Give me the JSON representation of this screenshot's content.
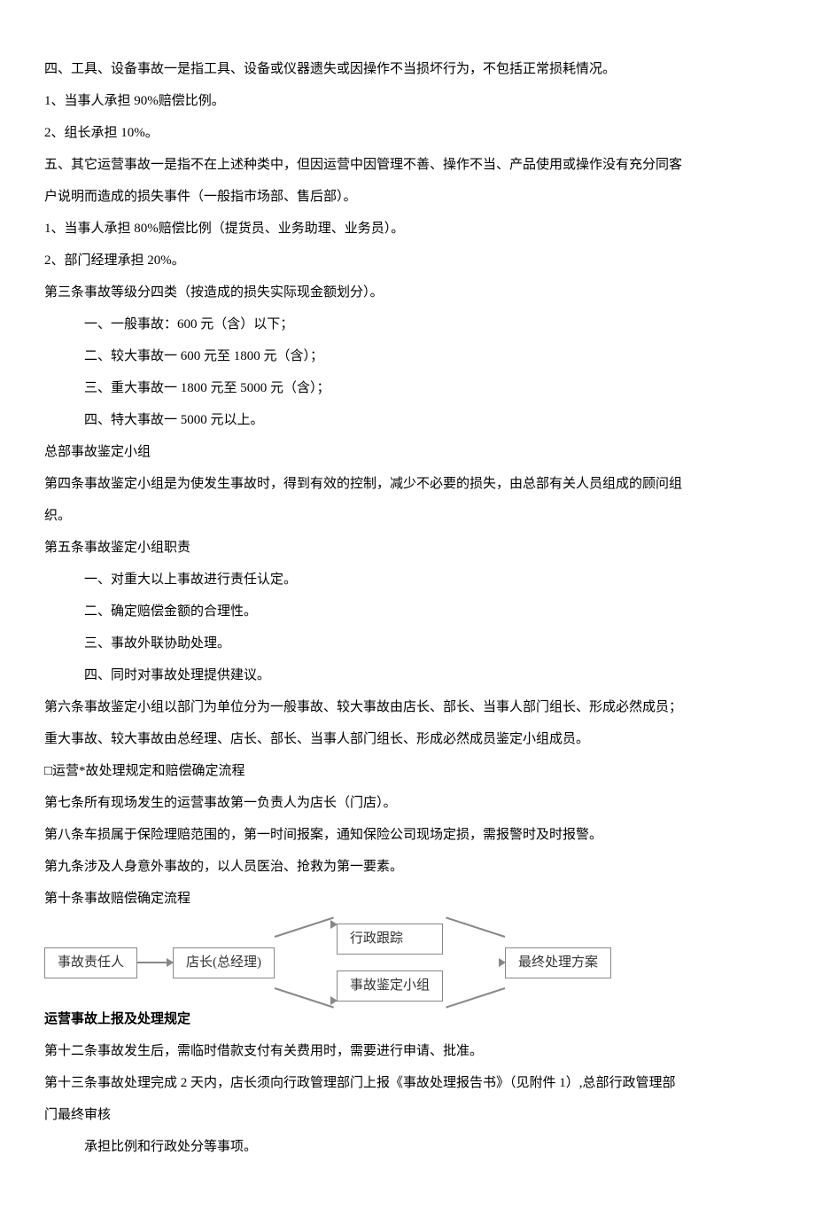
{
  "p1": "四、工具、设备事故一是指工具、设备或仪器遗失或因操作不当损坏行为，不包括正常损耗情况。",
  "p2": "1、当事人承担 90%赔偿比例。",
  "p3": "2、组长承担 10%。",
  "p4": "五、其它运营事故一是指不在上述种类中，但因运营中因管理不善、操作不当、产品使用或操作没有充分同客户说明而造成的损失事件（一般指市场部、售后部）。",
  "p5": "1、当事人承担 80%赔偿比例（提货员、业务助理、业务员）。",
  "p6": "2、部门经理承担 20%。",
  "p7": "第三条事故等级分四类（按造成的损失实际现金额划分）。",
  "p8": "一、一般事故：600 元（含）以下；",
  "p9": "二、较大事故一 600 元至 1800 元（含）；",
  "p10": "三、重大事故一 1800 元至 5000 元（含）；",
  "p11": "四、特大事故一 5000 元以上。",
  "p12": "总部事故鉴定小组",
  "p13": "第四条事故鉴定小组是为使发生事故时，得到有效的控制，减少不必要的损失，由总部有关人员组成的顾问组织。",
  "p14": "第五条事故鉴定小组职责",
  "p15": "一、对重大以上事故进行责任认定。",
  "p16": "二、确定赔偿金额的合理性。",
  "p17": "三、事故外联协助处理。",
  "p18": "四、同时对事故处理提供建议。",
  "p19": "第六条事故鉴定小组以部门为单位分为一般事故、较大事故由店长、部长、当事人部门组长、形成必然成员；重大事故、较大事故由总经理、店长、部长、当事人部门组长、形成必然成员鉴定小组成员。",
  "p20": "□运营*故处理规定和赔偿确定流程",
  "p21": "第七条所有现场发生的运营事故第一负责人为店长（门店）。",
  "p22": "第八条车损属于保险理赔范围的，第一时间报案，通知保险公司现场定损，需报警时及时报警。",
  "p23": "第九条涉及人身意外事故的，以人员医治、抢救为第一要素。",
  "p24": "第十条事故赔偿确定流程",
  "flow": {
    "b1": "事故责任人",
    "b2": "店长(总经理)",
    "b3": "行政跟踪",
    "b4": "事故鉴定小组",
    "b5": "最终处理方案"
  },
  "p25": "运营事故上报及处理规定",
  "p26": "第十二条事故发生后，需临时借款支付有关费用时，需要进行申请、批准。",
  "p27": "第十三条事故处理完成 2 天内，店长须向行政管理部门上报《事故处理报告书》（见附件 1）,总部行政管理部门最终审核承担比例和行政处分等事项。",
  "p27b": "承担比例和行政处分等事项。"
}
